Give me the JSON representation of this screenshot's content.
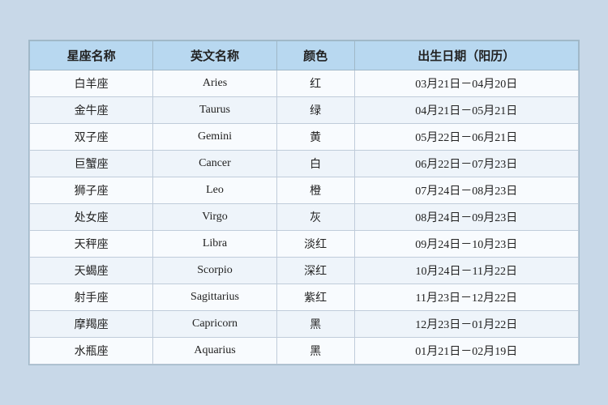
{
  "table": {
    "headers": [
      "星座名称",
      "英文名称",
      "颜色",
      "出生日期（阳历）"
    ],
    "rows": [
      {
        "chinese": "白羊座",
        "english": "Aries",
        "color": "红",
        "dates": "03月21日－04月20日"
      },
      {
        "chinese": "金牛座",
        "english": "Taurus",
        "color": "绿",
        "dates": "04月21日－05月21日"
      },
      {
        "chinese": "双子座",
        "english": "Gemini",
        "color": "黄",
        "dates": "05月22日－06月21日"
      },
      {
        "chinese": "巨蟹座",
        "english": "Cancer",
        "color": "白",
        "dates": "06月22日－07月23日"
      },
      {
        "chinese": "狮子座",
        "english": "Leo",
        "color": "橙",
        "dates": "07月24日－08月23日"
      },
      {
        "chinese": "处女座",
        "english": "Virgo",
        "color": "灰",
        "dates": "08月24日－09月23日"
      },
      {
        "chinese": "天秤座",
        "english": "Libra",
        "color": "淡红",
        "dates": "09月24日－10月23日"
      },
      {
        "chinese": "天蝎座",
        "english": "Scorpio",
        "color": "深红",
        "dates": "10月24日－11月22日"
      },
      {
        "chinese": "射手座",
        "english": "Sagittarius",
        "color": "紫红",
        "dates": "11月23日－12月22日"
      },
      {
        "chinese": "摩羯座",
        "english": "Capricorn",
        "color": "黑",
        "dates": "12月23日－01月22日"
      },
      {
        "chinese": "水瓶座",
        "english": "Aquarius",
        "color": "黑",
        "dates": "01月21日－02月19日"
      }
    ]
  }
}
